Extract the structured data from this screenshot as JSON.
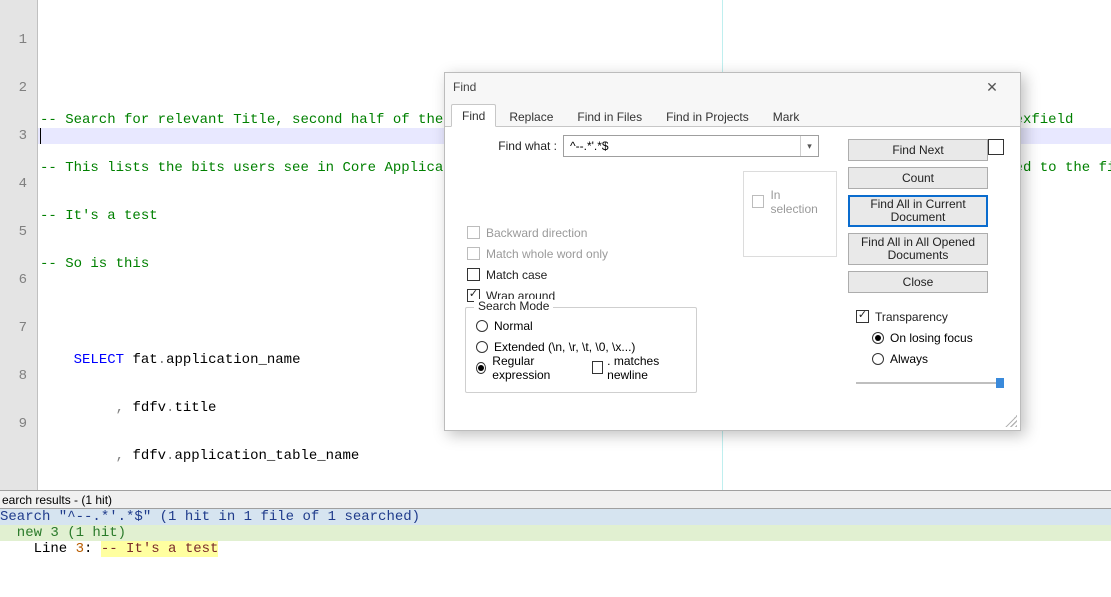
{
  "editor": {
    "lines": [
      "-- Search for relevant Title, second half of the screen, under \"Context Field Values\" lists the main parts of the Flexfield",
      "-- This lists the bits users see in Core Applications when they click into the DFF plus shows if there is a LOV linked to the field",
      "-- It's a test",
      "-- So is this",
      "",
      "    SELECT fat.application_name",
      "         , fdfv.title",
      "         , fdfv.application_table_name",
      ""
    ],
    "line_numbers": [
      "1",
      "2",
      "3",
      "4",
      "5",
      "6",
      "7",
      "8",
      "9"
    ]
  },
  "results": {
    "header": "earch results - (1 hit)",
    "search_line": "Search \"^--.*'.*$\" (1 hit in 1 file of 1 searched)",
    "file_line": "  new 3 (1 hit)",
    "hit_prefix": "    Line ",
    "hit_linenum": "3",
    "hit_sep": ": ",
    "hit_match": "-- It's a test"
  },
  "dialog": {
    "title": "Find",
    "tabs": {
      "find": "Find",
      "replace": "Replace",
      "findinfiles": "Find in Files",
      "findinprojects": "Find in Projects",
      "mark": "Mark"
    },
    "findwhat_label": "Find what :",
    "findwhat_value": "^--.*'.*$",
    "in_selection": "In selection",
    "opts": {
      "backward": "Backward direction",
      "wholeword": "Match whole word only",
      "matchcase": "Match case",
      "wrap": "Wrap around"
    },
    "searchmode": {
      "legend": "Search Mode",
      "normal": "Normal",
      "extended": "Extended (\\n, \\r, \\t, \\0, \\x...)",
      "regex": "Regular expression",
      "dotnl": ". matches newline"
    },
    "transp": {
      "label": "Transparency",
      "losing": "On losing focus",
      "always": "Always"
    },
    "buttons": {
      "findnext": "Find Next",
      "count": "Count",
      "findall_current": "Find All in Current Document",
      "findall_open": "Find All in All Opened Documents",
      "close": "Close"
    }
  }
}
